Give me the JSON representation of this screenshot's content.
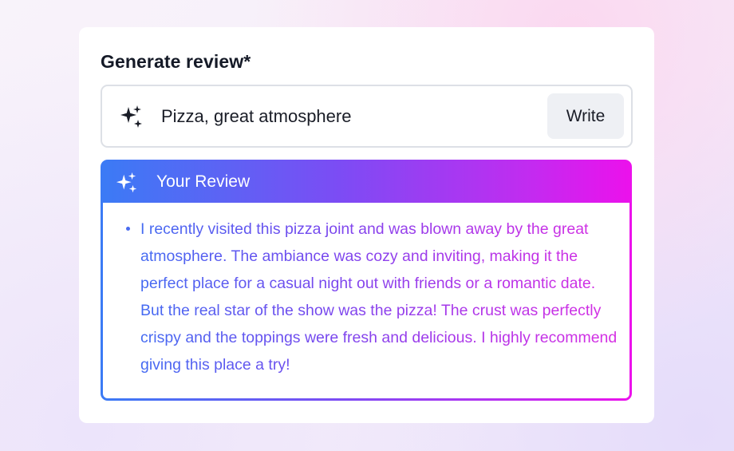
{
  "form": {
    "title": "Generate review*",
    "input": {
      "value": "Pizza, great atmosphere",
      "icon": "sparkle-icon"
    },
    "write_button_label": "Write"
  },
  "review": {
    "header": {
      "title": "Your Review",
      "icon": "sparkle-icon"
    },
    "items": [
      "I recently visited this pizza joint and was blown away by the great atmosphere. The ambiance was cozy and inviting, making it the perfect place for a casual night out with friends or a romantic date. But the real star of the show was the pizza! The crust was perfectly crispy and the toppings were fresh and delicious. I highly recommend giving this place a try!"
    ]
  },
  "colors": {
    "gradient_start": "#3b7bf5",
    "gradient_mid": "#7c4cf4",
    "gradient_end": "#ec11ec",
    "title_text": "#151a27",
    "button_bg": "#eef0f4"
  }
}
